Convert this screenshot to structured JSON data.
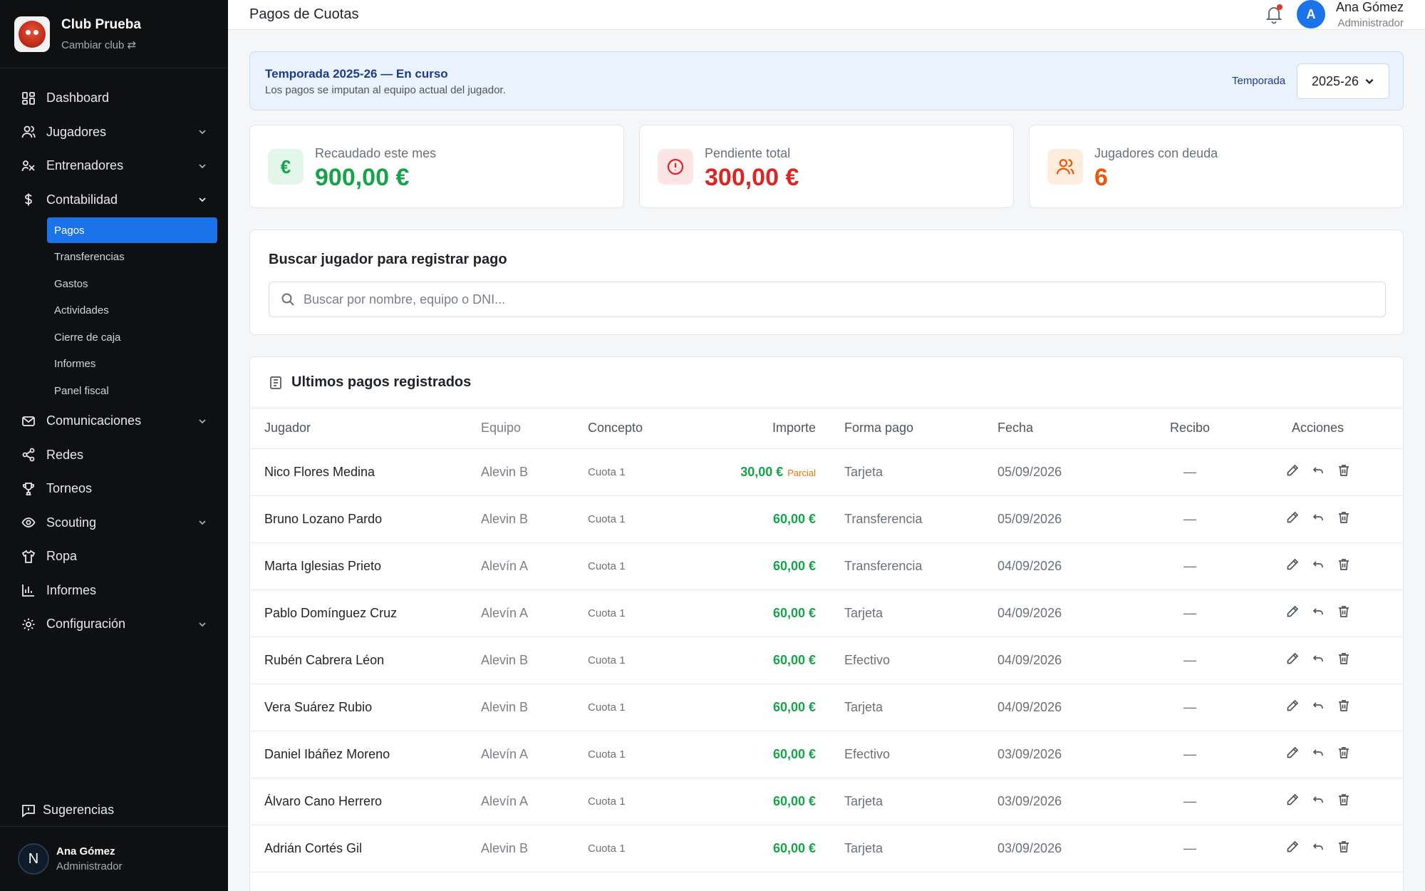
{
  "sidebar": {
    "club_name": "Club Prueba",
    "club_switch": "Cambiar club ⇄",
    "nav": [
      {
        "label": "Dashboard",
        "icon": "dashboard-icon"
      },
      {
        "label": "Jugadores",
        "icon": "users-icon"
      },
      {
        "label": "Entrenadores",
        "icon": "coach-icon"
      },
      {
        "label": "Contabilidad",
        "icon": "dollar-icon"
      },
      {
        "label": "Comunicaciones",
        "icon": "mail-icon"
      },
      {
        "label": "Redes",
        "icon": "share-icon"
      },
      {
        "label": "Torneos",
        "icon": "trophy-icon"
      },
      {
        "label": "Scouting",
        "icon": "eye-icon"
      },
      {
        "label": "Ropa",
        "icon": "shirt-icon"
      },
      {
        "label": "Informes",
        "icon": "bar-chart-icon"
      },
      {
        "label": "Configuración",
        "icon": "gear-icon"
      }
    ],
    "sub": [
      "Pagos",
      "Transferencias",
      "Gastos",
      "Actividades",
      "Cierre de caja",
      "Informes",
      "Panel fiscal"
    ],
    "suggestions": "Sugerencias",
    "user": {
      "initial": "N",
      "name": "Ana Gómez",
      "role": "Administrador"
    }
  },
  "header": {
    "title": "Pagos de Cuotas",
    "user_initial": "A",
    "user_name": "Ana Gómez",
    "user_role": "Administrador"
  },
  "season": {
    "title": "Temporada 2025-26 — En curso",
    "subtitle": "Los pagos se imputan al equipo actual del jugador.",
    "label": "Temporada",
    "selected": "2025-26"
  },
  "kpis": [
    {
      "label": "Recaudado este mes",
      "value": "900,00 €",
      "color": "#16a34a",
      "bg": "#e3f6ea",
      "icon": "euro-icon"
    },
    {
      "label": "Pendiente total",
      "value": "300,00 €",
      "color": "#dc2626",
      "bg": "#fde5e5",
      "icon": "alert-icon"
    },
    {
      "label": "Jugadores con deuda",
      "value": "6",
      "color": "#ea580c",
      "bg": "#feeddc",
      "icon": "users-icon"
    }
  ],
  "search": {
    "title": "Buscar jugador para registrar pago",
    "placeholder": "Buscar por nombre, equipo o DNI..."
  },
  "payments": {
    "title": "Ultimos pagos registrados",
    "columns": [
      "Jugador",
      "Equipo",
      "Concepto",
      "Importe",
      "Forma pago",
      "Fecha",
      "Recibo",
      "Acciones"
    ],
    "rows": [
      {
        "player": "Nico Flores Medina",
        "team": "Alevin B",
        "concept": "Cuota 1",
        "amount": "30,00 €",
        "partial": "Parcial",
        "method": "Tarjeta",
        "date": "05/09/2026",
        "receipt": "—"
      },
      {
        "player": "Bruno Lozano Pardo",
        "team": "Alevin B",
        "concept": "Cuota 1",
        "amount": "60,00 €",
        "partial": "",
        "method": "Transferencia",
        "date": "05/09/2026",
        "receipt": "—"
      },
      {
        "player": "Marta Iglesias Prieto",
        "team": "Alevín A",
        "concept": "Cuota 1",
        "amount": "60,00 €",
        "partial": "",
        "method": "Transferencia",
        "date": "04/09/2026",
        "receipt": "—"
      },
      {
        "player": "Pablo Domínguez Cruz",
        "team": "Alevín A",
        "concept": "Cuota 1",
        "amount": "60,00 €",
        "partial": "",
        "method": "Tarjeta",
        "date": "04/09/2026",
        "receipt": "—"
      },
      {
        "player": "Rubén Cabrera Léon",
        "team": "Alevin B",
        "concept": "Cuota 1",
        "amount": "60,00 €",
        "partial": "",
        "method": "Efectivo",
        "date": "04/09/2026",
        "receipt": "—"
      },
      {
        "player": "Vera Suárez Rubio",
        "team": "Alevin B",
        "concept": "Cuota 1",
        "amount": "60,00 €",
        "partial": "",
        "method": "Tarjeta",
        "date": "04/09/2026",
        "receipt": "—"
      },
      {
        "player": "Daniel Ibáñez Moreno",
        "team": "Alevín A",
        "concept": "Cuota 1",
        "amount": "60,00 €",
        "partial": "",
        "method": "Efectivo",
        "date": "03/09/2026",
        "receipt": "—"
      },
      {
        "player": "Álvaro Cano Herrero",
        "team": "Alevín A",
        "concept": "Cuota 1",
        "amount": "60,00 €",
        "partial": "",
        "method": "Tarjeta",
        "date": "03/09/2026",
        "receipt": "—"
      },
      {
        "player": "Adrián Cortés Gil",
        "team": "Alevin B",
        "concept": "Cuota 1",
        "amount": "60,00 €",
        "partial": "",
        "method": "Tarjeta",
        "date": "03/09/2026",
        "receipt": "—"
      }
    ]
  }
}
